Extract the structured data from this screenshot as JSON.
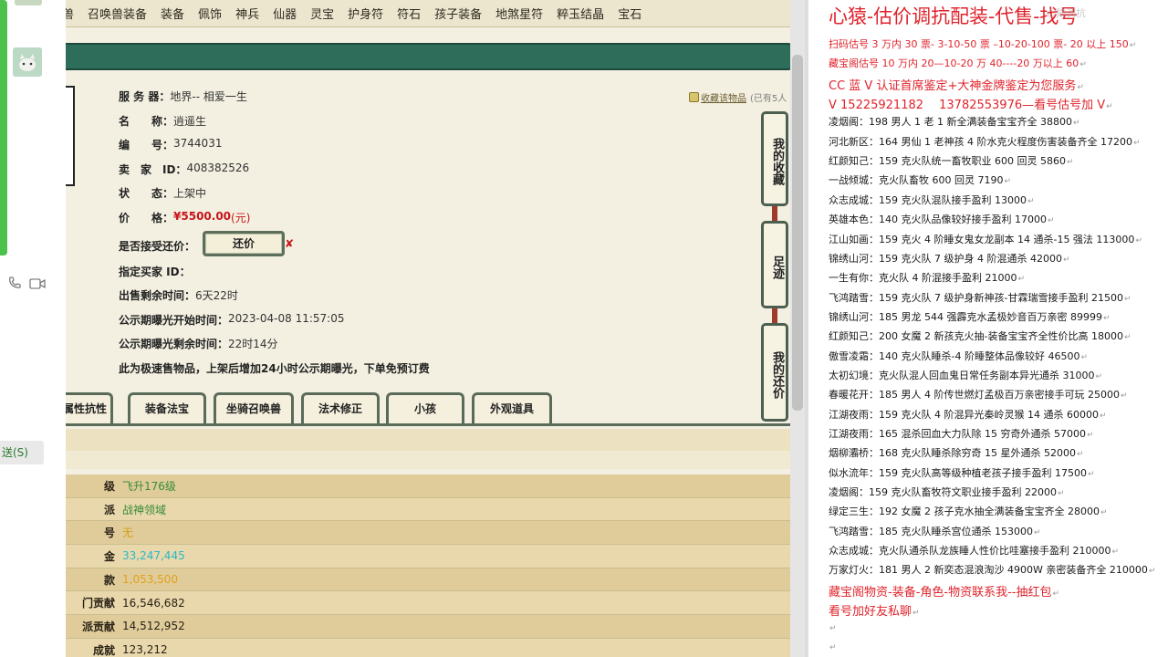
{
  "chat": {
    "send_button": "送(S)"
  },
  "nav": {
    "items": [
      "兽",
      "召唤兽装备",
      "装备",
      "佩饰",
      "神兵",
      "仙器",
      "灵宝",
      "护身符",
      "符石",
      "孩子装备",
      "地煞星符",
      "粹玉结晶",
      "宝石"
    ]
  },
  "listing": {
    "server_label": "服 务 器：",
    "server_value": "地界-- 相爱一生",
    "name_label": "名　　称：",
    "name_value": "逍遥生",
    "id_label": "编　　号：",
    "id_value": "3744031",
    "seller_label": "卖　家　ID：",
    "seller_value": "408382526",
    "status_label": "状　　态：",
    "status_value": "上架中",
    "price_label": "价　　格：",
    "price_value": "¥5500.00",
    "price_unit": "(元)",
    "counter_label": "是否接受还价：",
    "counter_button": "还价",
    "counter_mark": "✘",
    "buyer_label": "指定买家 ID：",
    "remaining_label": "出售剩余时间：",
    "remaining_value": "6天22时",
    "public_start_label": "公示期曝光开始时间：",
    "public_start_value": "2023-04-08 11:57:05",
    "public_remaining_label": "公示期曝光剩余时间：",
    "public_remaining_value": "22时14分",
    "notice": "此为极速售物品，上架后增加24小时公示期曝光，下单免预订费"
  },
  "favorites": {
    "link": "收藏该物品",
    "count": "(已有5人"
  },
  "side_tabs": [
    "我的收藏",
    "足迹",
    "我的还价"
  ],
  "bottom_tabs": [
    "属性抗性",
    "装备法宝",
    "坐骑召唤兽",
    "法术修正",
    "小孩",
    "外观道具"
  ],
  "stats": [
    {
      "label": "级",
      "value": "飞升176级",
      "color": "#3a8a3a"
    },
    {
      "label": "派",
      "value": "战神领域",
      "color": "#3a8a3a"
    },
    {
      "label": "号",
      "value": "无",
      "color": "#d4a017"
    },
    {
      "label": "金",
      "value": "33,247,445",
      "color": "#2ab7c9"
    },
    {
      "label": "款",
      "value": "1,053,500",
      "color": "#e0a21a"
    },
    {
      "label": "门贡献",
      "value": "16,546,682",
      "color": "#2a2116"
    },
    {
      "label": "派贡献",
      "value": "14,512,952",
      "color": "#2a2116"
    },
    {
      "label": "成就",
      "value": "123,212",
      "color": "#2a2116"
    }
  ],
  "notes": {
    "title": "心猿-估价调抗配装-代售-找号",
    "watermark": "心猿调抗",
    "lines": [
      {
        "text": "扫码估号 3 万内 30 票- 3-10-50 票 –10-20-100 票- 20 以上 150",
        "red": true
      },
      {
        "text": "藏宝阁估号 10 万内 20—10-20 万 40----20 万以上 60",
        "red": true
      },
      {
        "text": "CC 蓝 V 认证首席鉴定+大神金牌鉴定为您服务",
        "red": true,
        "big": true
      },
      {
        "text": "V 15225921182　 13782553976—看号估号加 V",
        "red": true,
        "big": true
      },
      {
        "text": "凌烟阁：198 男人 1 老 1 新全满装备宝宝齐全 38800"
      },
      {
        "text": "河北新区：164 男仙 1 老神孩 4 阶水克火程度伤害装备齐全 17200"
      },
      {
        "text": "红颜知己：159 克火队统一畜牧职业 600 回灵 5860"
      },
      {
        "text": "一战倾城：克火队畜牧 600 回灵 7190"
      },
      {
        "text": "众志成城：159 克火队混队接手盈利 13000"
      },
      {
        "text": "英雄本色：140 克火队品像较好接手盈利 17000"
      },
      {
        "text": "江山如画：159 克火 4 阶睡女鬼女龙副本 14 通杀-15 强法 113000"
      },
      {
        "text": "锦绣山河：159 克火队 7 级护身 4 阶混通杀 42000"
      },
      {
        "text": "一生有你：克火队 4 阶混接手盈利 21000"
      },
      {
        "text": "飞鸿踏雪：159 克火队 7 级护身新神孩-甘霖瑞雪接手盈利 21500"
      },
      {
        "text": "锦绣山河：185 男龙 544 强霹克水孟极妙音百万亲密 89999"
      },
      {
        "text": "红颜知己：200 女魔 2 新孩克火抽-装备宝宝齐全性价比高 18000"
      },
      {
        "text": "傲雪凌霜：140 克火队睡杀-4 阶睡整体品像较好 46500"
      },
      {
        "text": "太初幻境：克火队混人回血鬼日常任务副本异光通杀 31000"
      },
      {
        "text": "春暖花开：185 男人 4 阶传世燃灯孟极百万亲密接手可玩 25000"
      },
      {
        "text": "江湖夜雨：159 克火队 4 阶混异光秦岭灵猴 14 通杀 60000"
      },
      {
        "text": "江湖夜雨：165 混杀回血大力队除 15 穷奇外通杀 57000"
      },
      {
        "text": "烟柳灞桥：168 克火队睡杀除穷奇 15 星外通杀 52000"
      },
      {
        "text": "似水流年：159 克火队高等级种植老孩子接手盈利 17500"
      },
      {
        "text": "凌烟阁：159 克火队畜牧符文职业接手盈利 22000"
      },
      {
        "text": "绿定三生：192 女魔 2 孩子克水抽全满装备宝宝齐全 28000"
      },
      {
        "text": "飞鸿踏雪：185 克火队睡杀宫位通杀 153000"
      },
      {
        "text": "众志成城：克火队通杀队龙族睡人性价比哇塞接手盈利 210000"
      },
      {
        "text": "万家灯火：181 男人 2 新奕态混浪淘沙 4900W 亲密装备齐全 210000"
      },
      {
        "text": "藏宝阁物资-装备-角色-物资联系我--抽红包",
        "red": true,
        "big": true
      },
      {
        "text": "看号加好友私聊",
        "red": true,
        "big": true
      },
      {
        "text": ""
      },
      {
        "text": ""
      }
    ]
  }
}
